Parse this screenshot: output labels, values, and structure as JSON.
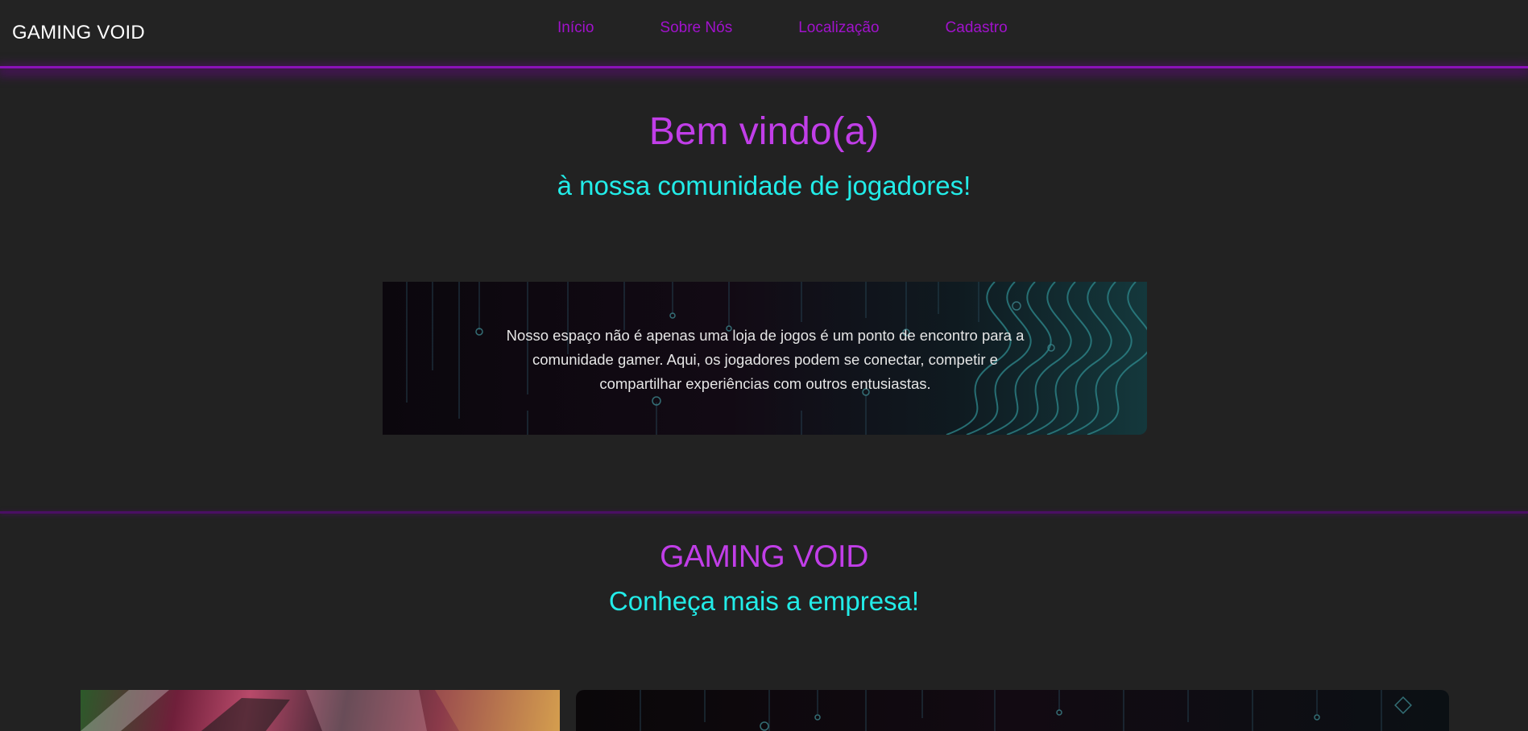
{
  "header": {
    "brand": "GAMING VOID",
    "nav": [
      "Início",
      "Sobre Nós",
      "Localização",
      "Cadastro"
    ]
  },
  "hero": {
    "title": "Bem vindo(a)",
    "subtitle": "à nossa comunidade de jogadores!"
  },
  "banner": {
    "text": "Nosso espaço não é apenas uma loja de jogos é um ponto de encontro para a comunidade gamer. Aqui, os jogadores podem se conectar, competir e compartilhar experiências com outros entusiastas."
  },
  "about": {
    "title": "GAMING VOID",
    "subtitle": "Conheça mais a empresa!"
  },
  "colors": {
    "background": "#222222",
    "accent_purple": "#c13ee8",
    "nav_purple": "#a112cc",
    "accent_cyan": "#22ece8"
  }
}
